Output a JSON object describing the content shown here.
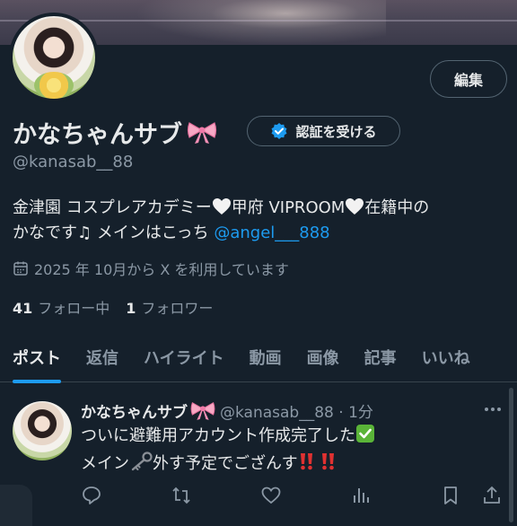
{
  "profile": {
    "edit_label": "編集",
    "display_name": "かなちゃんサブ",
    "verify_label": "認証を受ける",
    "handle": "@kanasab__88",
    "bio": {
      "part1": "金津園 コスプレアカデミー",
      "part2": "甲府 VIPROOM",
      "part3": "在籍中の",
      "line2_prefix": "かなです♫ メインはこっち ",
      "mention": "@angel___888"
    },
    "joined": "2025 年 10月から X を利用しています",
    "following_count": "41",
    "following_label": "フォロー中",
    "followers_count": "1",
    "followers_label": "フォロワー"
  },
  "tabs": [
    {
      "label": "ポスト",
      "active": true
    },
    {
      "label": "返信"
    },
    {
      "label": "ハイライト"
    },
    {
      "label": "動画"
    },
    {
      "label": "画像"
    },
    {
      "label": "記事"
    },
    {
      "label": "いいね"
    }
  ],
  "post": {
    "name": "かなちゃんサブ",
    "meta": "@kanasab__88 · 1分",
    "line1": "ついに避難用アカウント作成完了した",
    "line2a": "メイン",
    "line2b": "外す予定でござんす"
  },
  "icons": {
    "verify": "verified-badge-icon",
    "calendar": "calendar-icon",
    "ribbon": "pink-ribbon-icon",
    "heart": "white-heart-icon",
    "check": "green-check-icon",
    "key": "key-icon",
    "exclaim": "red-double-exclamation-icon",
    "reply": "reply-icon",
    "repost": "repost-icon",
    "like": "like-icon",
    "views": "views-icon",
    "bookmark": "bookmark-icon",
    "share": "share-icon",
    "more": "more-icon"
  },
  "colors": {
    "background": "#15202b",
    "accent": "#1d9bf0",
    "muted": "#8b98a5",
    "text": "#e7e9ea"
  }
}
